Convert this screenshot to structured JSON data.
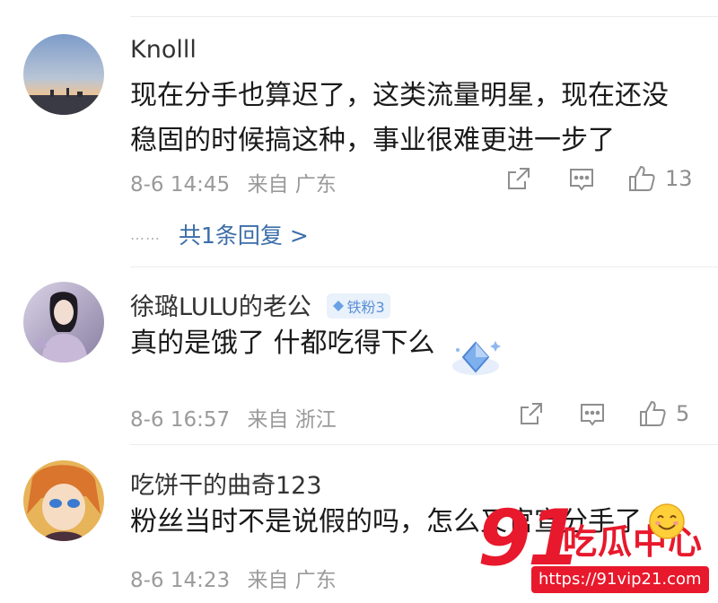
{
  "comments": [
    {
      "username": "Knolll",
      "text_lines": [
        "现在分手也算迟了，这类流量明星，现在还没",
        "稳固的时候搞这种，事业很难更进一步了"
      ],
      "date": "8-6 14:45",
      "source": "来自 广东",
      "likes": "13",
      "reply_dots": "……",
      "reply_link": "共1条回复 >"
    },
    {
      "username": "徐璐LULU的老公",
      "badge": "铁粉3",
      "text_lines": [
        "真的是饿了 什都吃得下么"
      ],
      "date": "8-6 16:57",
      "source": "来自 浙江",
      "likes": "5"
    },
    {
      "username": "吃饼干的曲奇123",
      "text_lines": [
        "粉丝当时不是说假的吗，怎么又官宣分手了"
      ],
      "date": "8-6 14:23",
      "source": "来自 广东"
    }
  ],
  "icons": {
    "share": "share-icon",
    "comment": "comment-icon",
    "like": "thumbs-up-icon",
    "badge_gem": "diamond-icon"
  },
  "colors": {
    "link": "#3b6ea8",
    "meta": "#9a9a9a",
    "badge_bg": "#e9f1fb",
    "badge_text": "#5b8fd6",
    "watermark": "#e8192c"
  },
  "watermark": {
    "number": "91",
    "title": "吃瓜中心",
    "url": "https://91vip21.com"
  }
}
